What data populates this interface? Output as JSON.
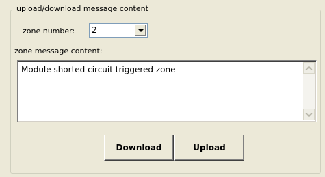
{
  "group": {
    "title": "upload/download message content"
  },
  "zone": {
    "label": "zone number:",
    "value": "2"
  },
  "content": {
    "label": "zone message content:",
    "text": "Module shorted circuit triggered zone"
  },
  "buttons": {
    "download": "Download",
    "upload": "Upload"
  },
  "icons": {
    "combo_arrow": "chevron-down-icon",
    "scroll_up": "chevron-up-icon",
    "scroll_down": "chevron-down-icon"
  }
}
